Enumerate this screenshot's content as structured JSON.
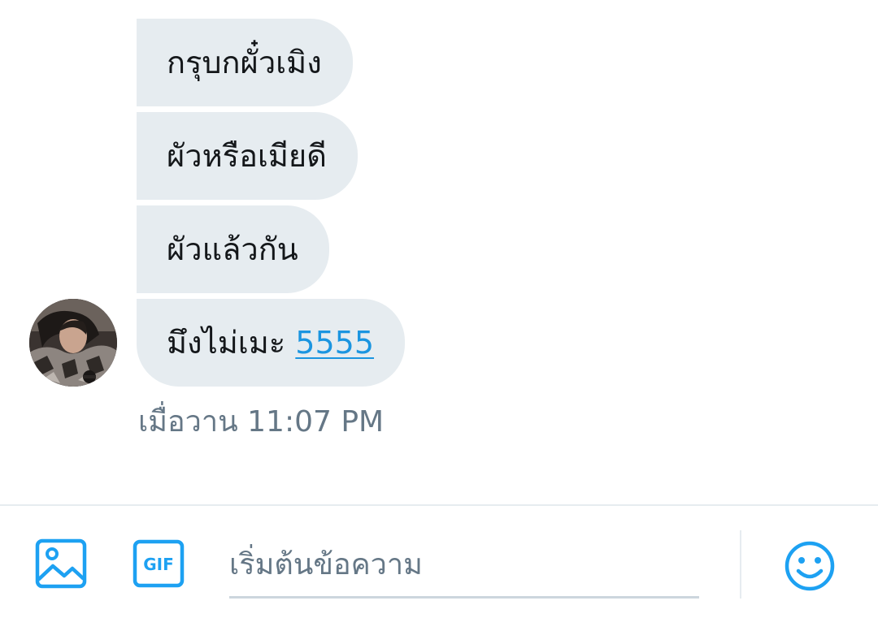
{
  "conversation": {
    "messages": [
      {
        "text": "กรุบกผั๋วเมิง"
      },
      {
        "text": "ผัวหรือเมียดี"
      },
      {
        "text": "ผัวแล้วกัน"
      },
      {
        "text": "มึงไม่เมะ ",
        "link": "5555"
      }
    ],
    "timestamp": "เมื่อวาน 11:07 PM"
  },
  "composer": {
    "placeholder": "เริ่มต้นข้อความ",
    "media_icon": "image-icon",
    "gif_label": "GIF",
    "emoji_icon": "smiley-icon"
  },
  "colors": {
    "bubble": "#e6ecf0",
    "text": "#14171a",
    "link": "#1b95e0",
    "secondary": "#657786",
    "accent": "#1da1f2"
  }
}
